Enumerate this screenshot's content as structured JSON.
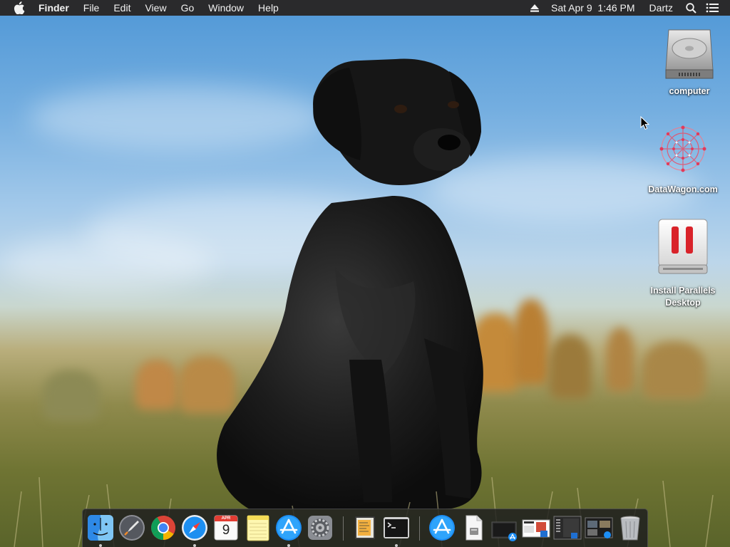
{
  "menubar": {
    "app_name": "Finder",
    "menus": [
      "File",
      "Edit",
      "View",
      "Go",
      "Window",
      "Help"
    ],
    "date_time": "Sat Apr 9  1:46 PM",
    "user": "Dartz",
    "icons": [
      "apple-icon",
      "eject-icon",
      "spotlight-search-icon",
      "notification-center-icon"
    ]
  },
  "desktop_icons": [
    {
      "label": "computer",
      "icon": "hard-drive-icon"
    },
    {
      "label": "DataWagon.com",
      "icon": "datawagon-logo-icon"
    },
    {
      "label": "Install Parallels Desktop",
      "icon": "parallels-installer-icon"
    }
  ],
  "dock": {
    "calendar": {
      "month": "APR",
      "day": "9"
    },
    "apps": [
      {
        "name": "Finder",
        "running": true
      },
      {
        "name": "Launchpad",
        "running": false
      },
      {
        "name": "Google Chrome",
        "running": false
      },
      {
        "name": "Safari",
        "running": true
      },
      {
        "name": "Calendar",
        "running": false
      },
      {
        "name": "Notes",
        "running": false
      },
      {
        "name": "App Store",
        "running": true
      },
      {
        "name": "System Preferences",
        "running": false
      },
      {
        "name": "Sublime Text",
        "running": false
      },
      {
        "name": "Terminal",
        "running": true
      },
      {
        "name": "Applications",
        "running": false
      },
      {
        "name": "Documents",
        "running": false
      },
      {
        "name": "Downloads",
        "running": false
      },
      {
        "name": "Screenshot 1",
        "running": false
      },
      {
        "name": "Screenshot 2",
        "running": false
      },
      {
        "name": "Screenshot 3",
        "running": false
      },
      {
        "name": "Trash",
        "running": false
      }
    ]
  },
  "colors": {
    "menubar_bg": "#2a2a2c",
    "parallels_red": "#d9232a",
    "sky": "#6aaade"
  }
}
